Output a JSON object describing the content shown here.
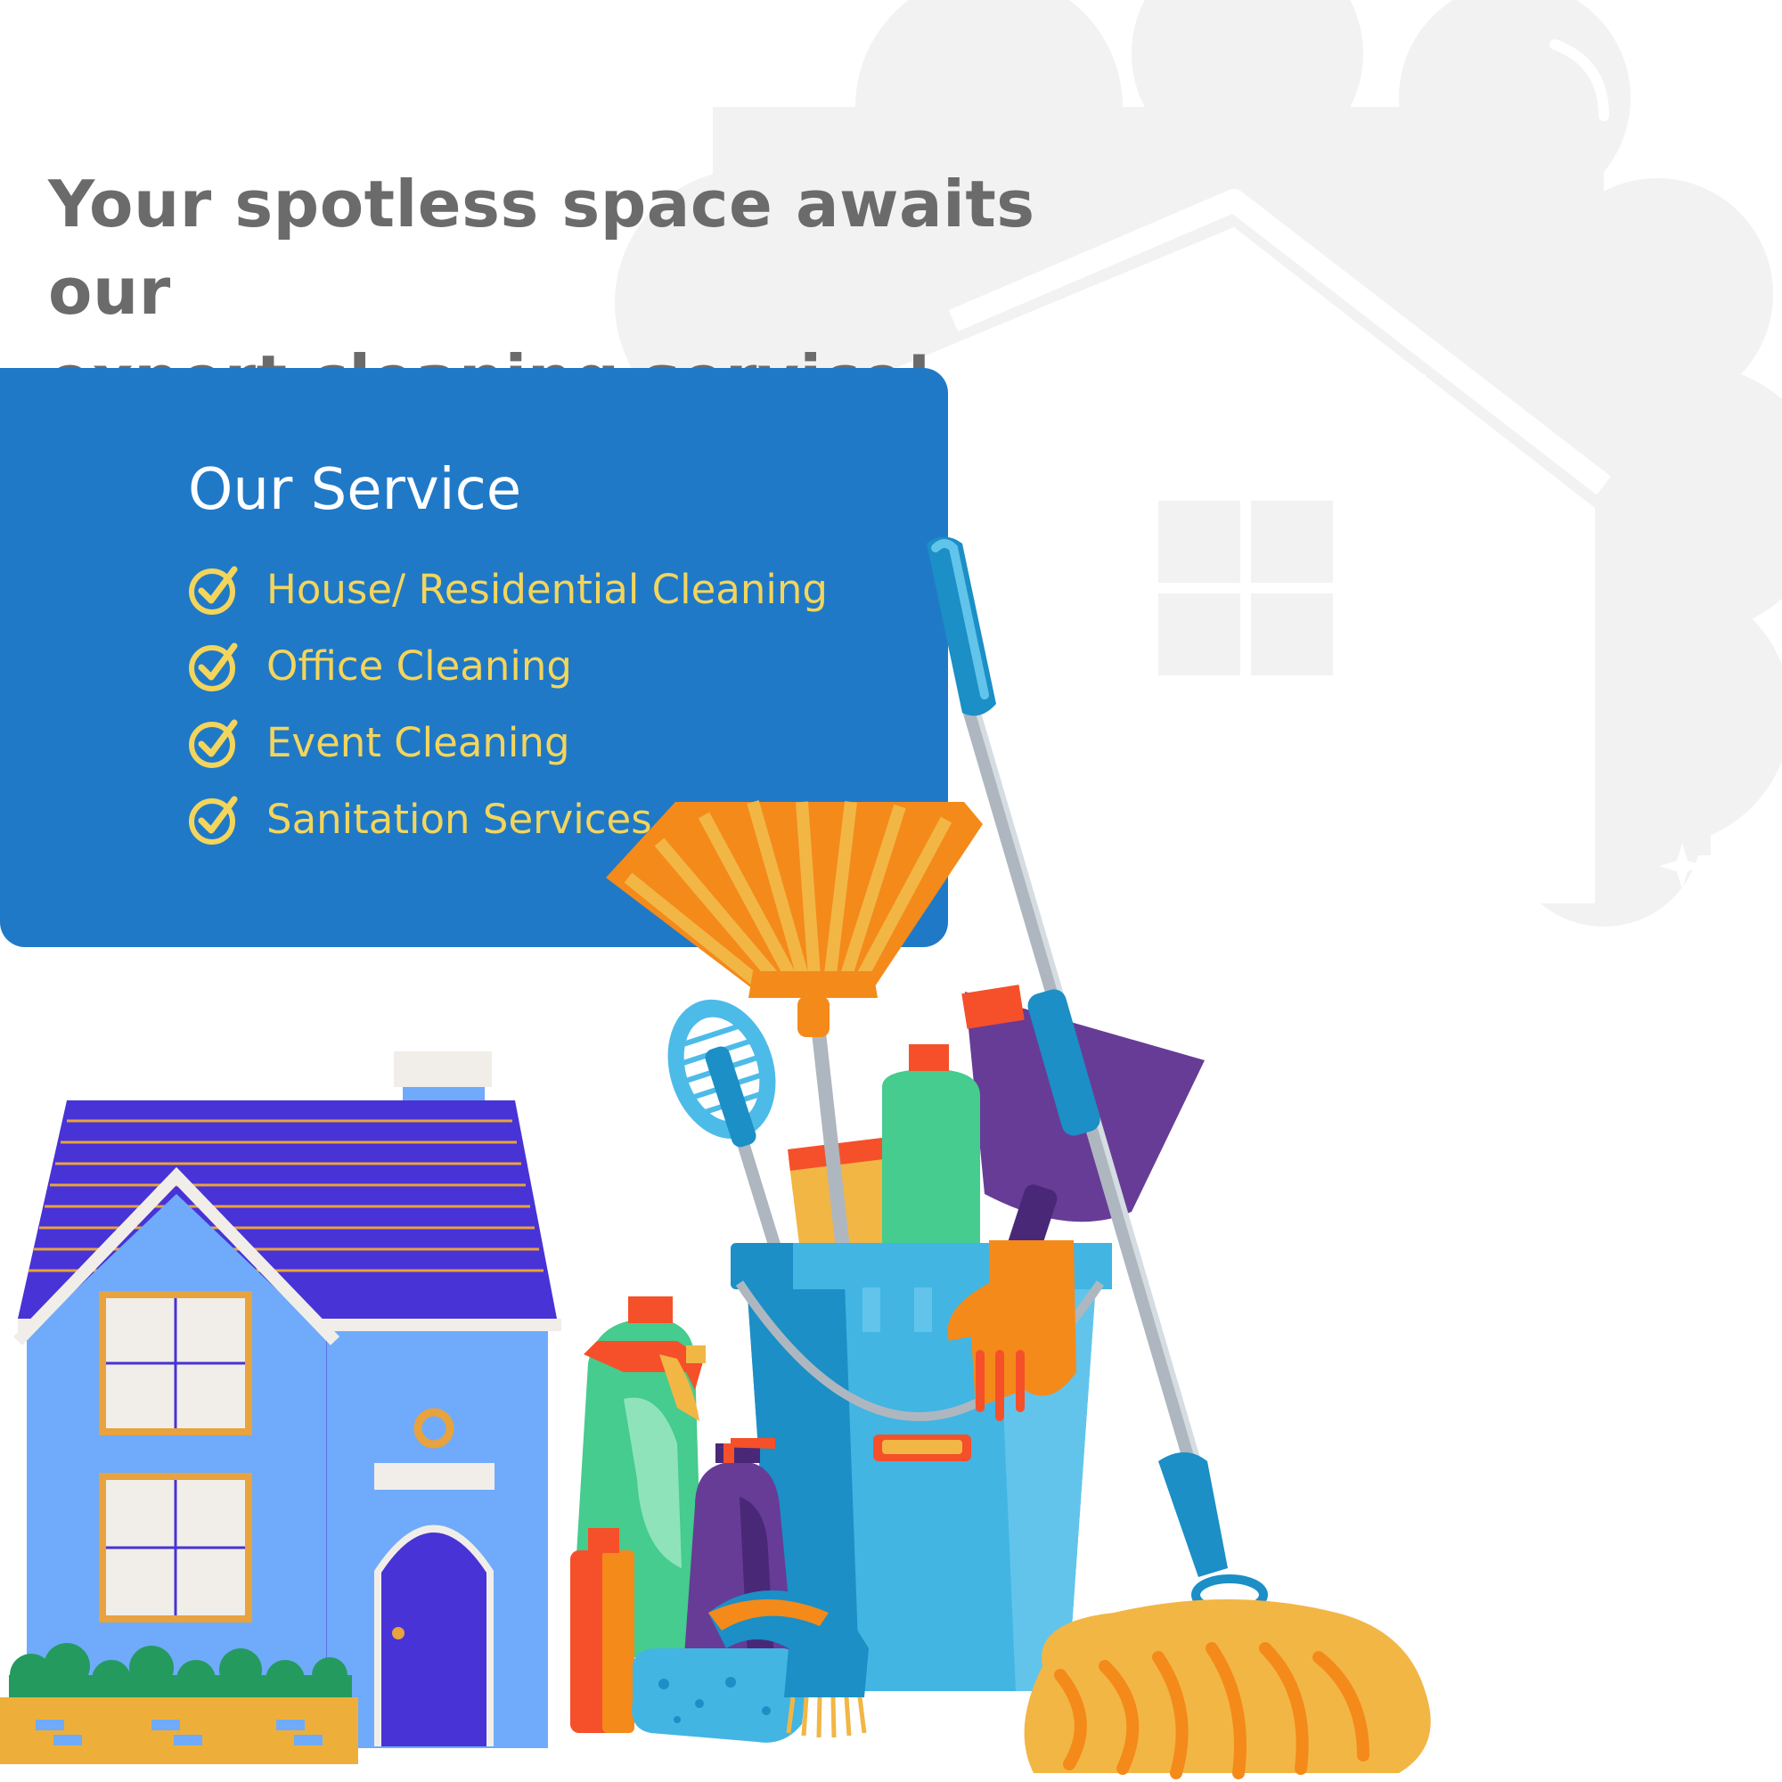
{
  "headline": {
    "line1": "Your spotless space awaits our",
    "line2": "expert cleaning service!"
  },
  "services": {
    "title": "Our Service",
    "items": [
      "House/ Residential Cleaning",
      "Office Cleaning",
      "Event Cleaning",
      "Sanitation Services"
    ]
  },
  "colors": {
    "card_blue": "#2079c7",
    "accent_yellow": "#f3d55c",
    "headline_gray": "#6b6b6b",
    "bg_shape_gray": "#f2f2f2"
  },
  "icons": {
    "check": "check-circle-icon",
    "background": "house-cloud-icon",
    "illustration": "cleaning-supplies-illustration"
  }
}
